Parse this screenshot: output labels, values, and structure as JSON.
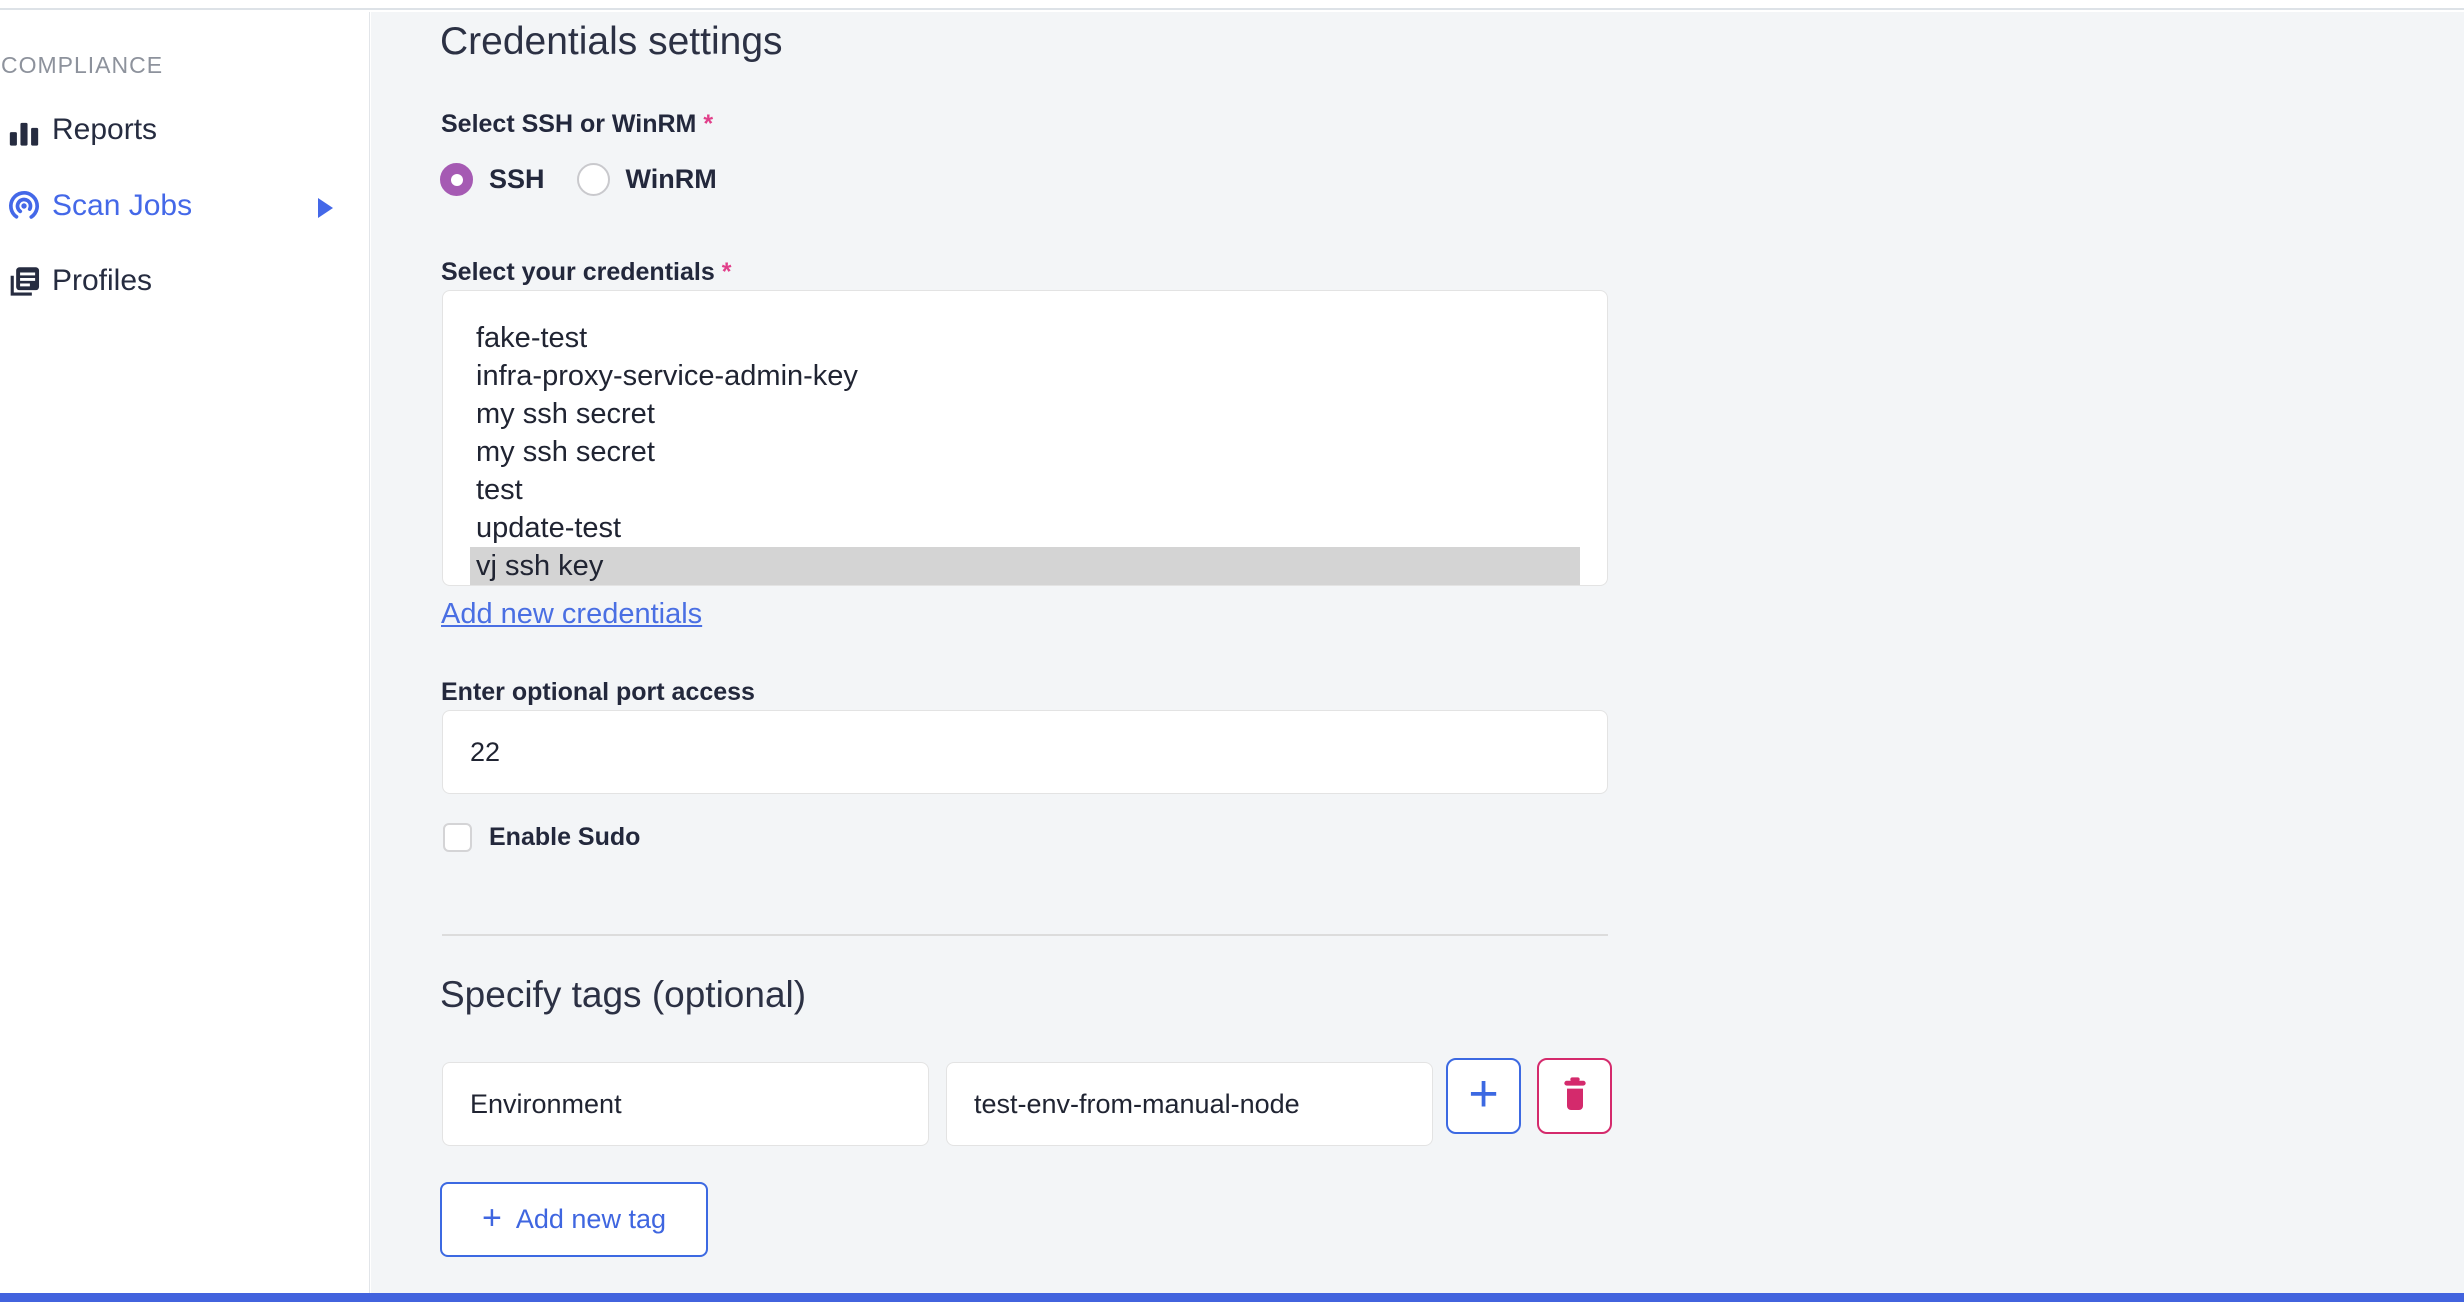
{
  "sidebar": {
    "section_label": "COMPLIANCE",
    "items": [
      {
        "label": "Reports",
        "icon": "bar-chart-icon",
        "active": false
      },
      {
        "label": "Scan Jobs",
        "icon": "scan-target-icon",
        "active": true,
        "has_submenu": true
      },
      {
        "label": "Profiles",
        "icon": "documents-icon",
        "active": false
      }
    ]
  },
  "main": {
    "title": "Credentials settings",
    "protocol": {
      "label": "Select SSH or WinRM",
      "required_marker": "*",
      "options": [
        {
          "label": "SSH",
          "selected": true
        },
        {
          "label": "WinRM",
          "selected": false
        }
      ]
    },
    "credentials": {
      "label": "Select your credentials",
      "required_marker": "*",
      "options": [
        "fake-test",
        "infra-proxy-service-admin-key",
        "my ssh secret",
        "my ssh secret",
        "test",
        "update-test",
        "vj ssh key"
      ],
      "selected_option": "vj ssh key",
      "add_link_label": "Add new credentials"
    },
    "port": {
      "label": "Enter optional port access",
      "value": "22"
    },
    "sudo": {
      "label": "Enable Sudo",
      "checked": false
    },
    "tags": {
      "title": "Specify tags (optional)",
      "rows": [
        {
          "key": "Environment",
          "value": "test-env-from-manual-node"
        }
      ],
      "plus_button_label": "+",
      "add_button_plus": "+",
      "add_button_label": "Add new tag"
    }
  },
  "colors": {
    "accent_blue": "#4468e8",
    "link_blue": "#4a6fe3",
    "radio_purple": "#a55ab3",
    "required_pink": "#e13f8a",
    "danger_pink": "#d42a6c",
    "selected_row_gray": "#d4d4d4",
    "main_background": "#f3f5f7",
    "bottom_bar_blue": "#4263de"
  }
}
